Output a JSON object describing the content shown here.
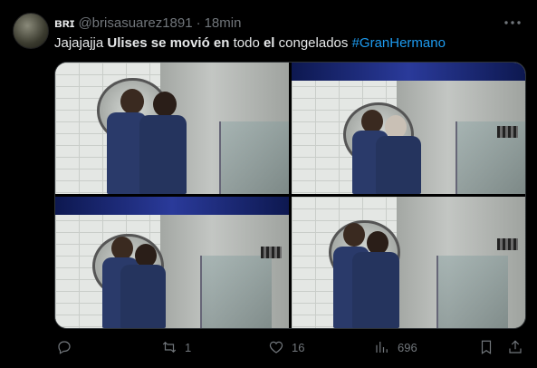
{
  "tweet": {
    "display_name": "ʙʀɪ",
    "handle": "@brisasuarez1891",
    "separator": "·",
    "time": "18min",
    "text_parts": {
      "p1": "Jajajajja ",
      "p2": "Ulises se movió en",
      "p3": " todo ",
      "p4": "el",
      "p5": " congelados ",
      "hashtag": "#GranHermano"
    }
  },
  "actions": {
    "reply_count": "",
    "retweet_count": "1",
    "like_count": "16",
    "views_count": "696"
  },
  "icons": {
    "more": "more-icon",
    "reply": "reply-icon",
    "retweet": "retweet-icon",
    "like": "heart-icon",
    "views": "views-icon",
    "bookmark": "bookmark-icon",
    "share": "share-icon"
  },
  "colors": {
    "background": "#000000",
    "text": "#e7e9ea",
    "muted": "#71767b",
    "link": "#1d9bf0"
  }
}
